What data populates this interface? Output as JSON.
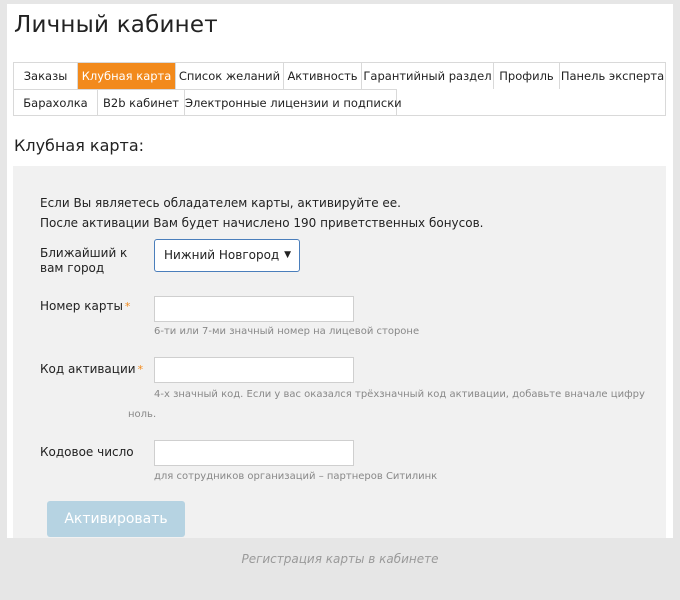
{
  "page_title": "Личный кабинет",
  "tabs_row1": [
    {
      "label": "Заказы",
      "active": false
    },
    {
      "label": "Клубная карта",
      "active": true
    },
    {
      "label": "Список желаний",
      "active": false
    },
    {
      "label": "Активность",
      "active": false
    },
    {
      "label": "Гарантийный раздел",
      "active": false
    },
    {
      "label": "Профиль",
      "active": false
    },
    {
      "label": "Панель эксперта",
      "active": false
    }
  ],
  "tabs_row2": [
    {
      "label": "Барахолка"
    },
    {
      "label": "B2b кабинет"
    },
    {
      "label": "Электронные лицензии и подписки"
    }
  ],
  "section_title": "Клубная карта:",
  "form": {
    "intro_line1": "Если Вы являетесь обладателем карты, активируйте ее.",
    "intro_line2": "После активации Вам будет начислено 190 приветственных бонусов.",
    "city_label_1": "Ближайший к",
    "city_label_2": "вам город",
    "city_value": "Нижний Новгород",
    "card_number_label": "Номер карты",
    "card_number_value": "",
    "card_number_hint": "6-ти или 7-ми значный номер на лицевой стороне",
    "activation_code_label": "Код активации",
    "activation_code_value": "",
    "activation_code_hint_1": "4-х значный код. Если у вас оказался трёхзначный код активации, добавьте вначале цифру",
    "activation_code_hint_2": "ноль.",
    "code_number_label": "Кодовое число",
    "code_number_value": "",
    "code_number_hint": "для сотрудников организаций – партнеров Ситилинк",
    "required_mark": "*",
    "submit_label": "Активировать"
  },
  "caption": "Регистрация карты в кабинете",
  "colors": {
    "accent": "#f28a1c",
    "button_disabled": "#b6d3e2",
    "select_border": "#4a7ebb"
  }
}
